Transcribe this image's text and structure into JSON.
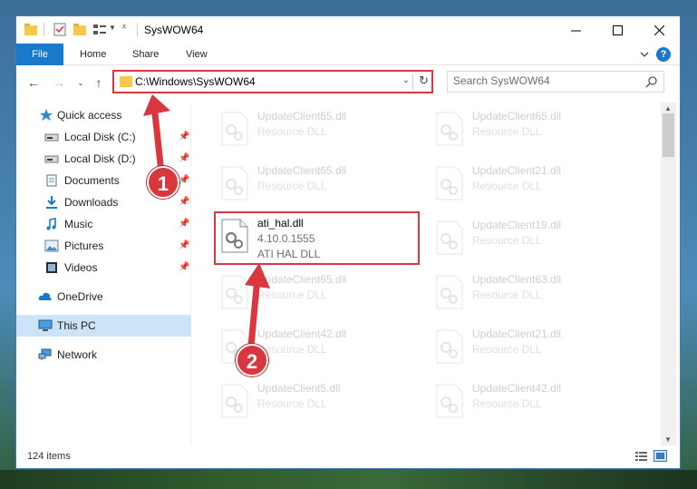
{
  "window": {
    "title": "SysWOW64"
  },
  "ribbon": {
    "file": "File",
    "home": "Home",
    "share": "Share",
    "view": "View",
    "help": "?"
  },
  "address": {
    "path": "C:\\Windows\\SysWOW64",
    "search_placeholder": "Search SysWOW64"
  },
  "sidebar": {
    "items": [
      {
        "label": "Quick access"
      },
      {
        "label": "Local Disk (C:)"
      },
      {
        "label": "Local Disk (D:)"
      },
      {
        "label": "Documents"
      },
      {
        "label": "Downloads"
      },
      {
        "label": "Music"
      },
      {
        "label": "Pictures"
      },
      {
        "label": "Videos"
      },
      {
        "label": "OneDrive"
      },
      {
        "label": "This PC"
      },
      {
        "label": "Network"
      }
    ]
  },
  "files": {
    "left": [
      {
        "name": "UpdateClient65.dll",
        "type": "Resource DLL"
      },
      {
        "name": "UpdateClient65.dll",
        "type": "Resource DLL"
      },
      {
        "name": "ati_hal.dll",
        "version": "4.10.0.1555",
        "type": "ATI HAL DLL"
      },
      {
        "name": "UpdateClient65.dll",
        "type": "Resource DLL"
      },
      {
        "name": "UpdateClient42.dll",
        "type": "Resource DLL"
      },
      {
        "name": "UpdateClient5.dll",
        "type": "Resource DLL"
      }
    ],
    "right": [
      {
        "name": "UpdateClient65.dll",
        "type": "Resource DLL"
      },
      {
        "name": "UpdateClient21.dll",
        "type": "Resource DLL"
      },
      {
        "name": "UpdateClient19.dll",
        "type": "Resource DLL"
      },
      {
        "name": "UpdateClient63.dll",
        "type": "Resource DLL"
      },
      {
        "name": "UpdateClient21.dll",
        "type": "Resource DLL"
      },
      {
        "name": "UpdateClient42.dll",
        "type": "Resource DLL"
      }
    ]
  },
  "status": {
    "count": "124 items"
  },
  "callouts": {
    "one": "1",
    "two": "2"
  },
  "colors": {
    "accent": "#1979ca",
    "highlight": "#d9363e",
    "selected": "#cce4f7"
  }
}
